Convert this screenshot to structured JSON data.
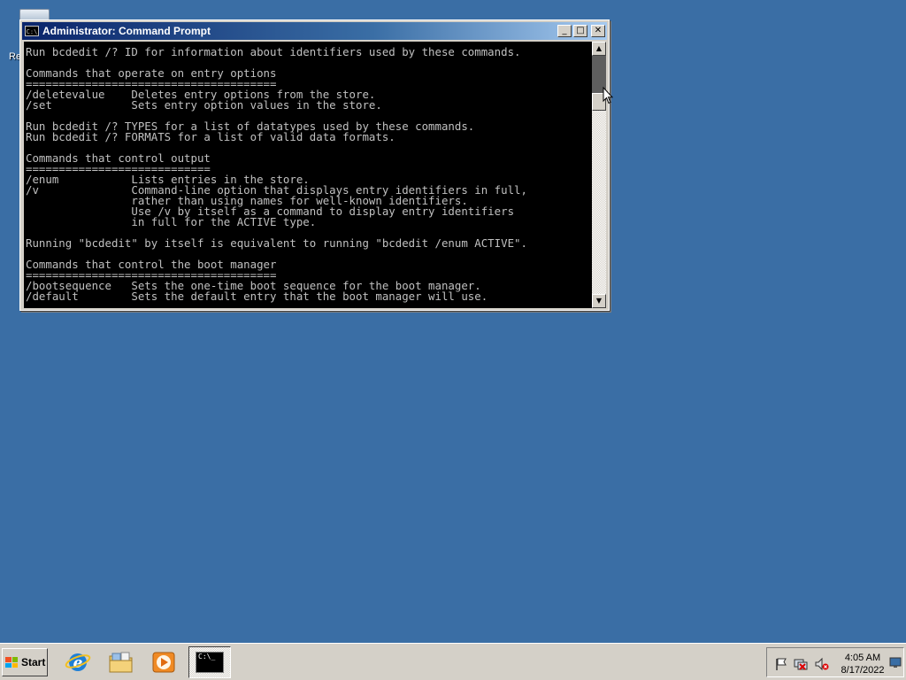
{
  "desktop": {
    "recycle_bin_label": "Re"
  },
  "window": {
    "title": "Administrator: Command Prompt",
    "app_icon_text": "C:\\",
    "minimize_glyph": "_",
    "maximize_glyph": "□",
    "close_glyph": "✕",
    "console_text": "Run bcdedit /? ID for information about identifiers used by these commands.\n\nCommands that operate on entry options\n======================================\n/deletevalue    Deletes entry options from the store.\n/set            Sets entry option values in the store.\n\nRun bcdedit /? TYPES for a list of datatypes used by these commands.\nRun bcdedit /? FORMATS for a list of valid data formats.\n\nCommands that control output\n============================\n/enum           Lists entries in the store.\n/v              Command-line option that displays entry identifiers in full,\n                rather than using names for well-known identifiers.\n                Use /v by itself as a command to display entry identifiers\n                in full for the ACTIVE type.\n\nRunning \"bcdedit\" by itself is equivalent to running \"bcdedit /enum ACTIVE\".\n\nCommands that control the boot manager\n======================================\n/bootsequence   Sets the one-time boot sequence for the boot manager.\n/default        Sets the default entry that the boot manager will use.",
    "scroll_up_glyph": "▲",
    "scroll_down_glyph": "▼"
  },
  "taskbar": {
    "start_label": "Start",
    "active_task_icon_text": "C:\\_",
    "clock_time": "4:05 AM",
    "clock_date": "8/17/2022"
  },
  "colors": {
    "desktop": "#3a6ea5",
    "title_active": "#0a246a",
    "console_bg": "#000000",
    "console_fg": "#c0c0c0"
  }
}
